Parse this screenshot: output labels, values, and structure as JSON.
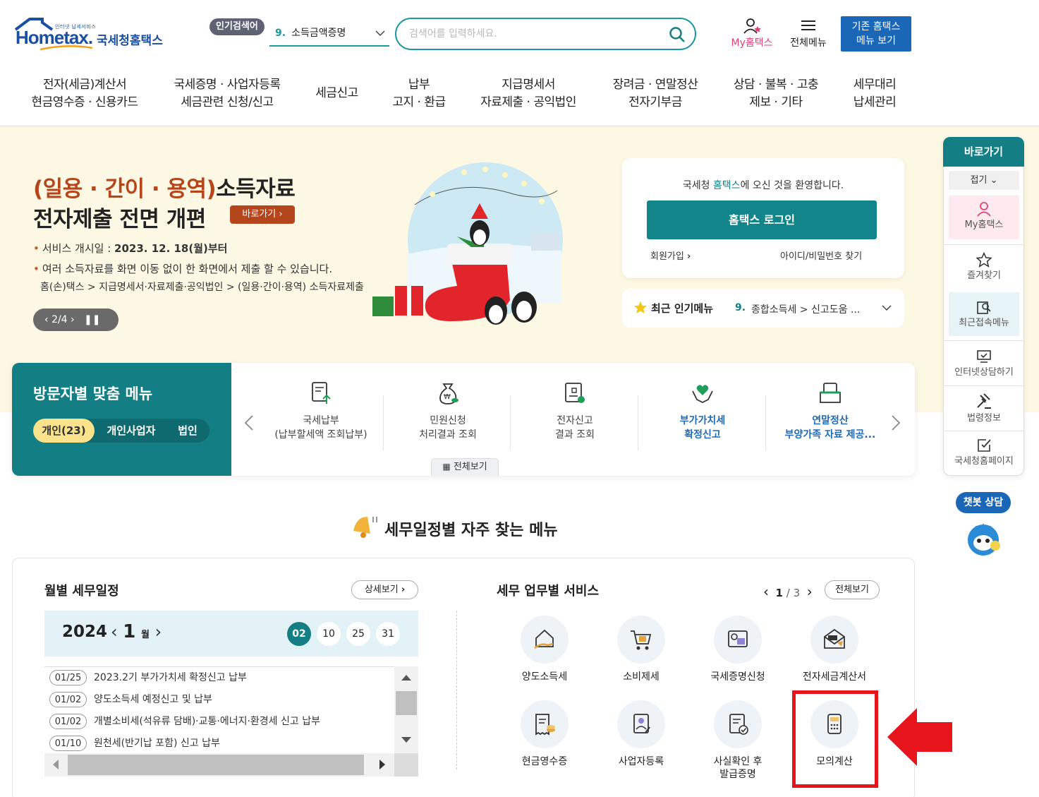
{
  "header": {
    "logo_sub": "인터넷 납세서비스",
    "logo_main": "Hometax.",
    "logo_kr": "국세청홈택스",
    "popular_badge": "인기검색어",
    "popular_num": "9.",
    "popular_term": "소득금액증명",
    "search_placeholder": "검색어를 입력하세요.",
    "my_hometax": "My홈택스",
    "all_menu": "전체메뉴",
    "old_menu_line1": "기존 홈택스",
    "old_menu_line2": "메뉴 보기"
  },
  "gnb": [
    {
      "l1": "전자(세금)계산서",
      "l2": "현금영수증 · 신용카드"
    },
    {
      "l1": "국세증명 · 사업자등록",
      "l2": "세금관련 신청/신고"
    },
    {
      "l1": "세금신고",
      "l2": ""
    },
    {
      "l1": "납부",
      "l2": "고지 · 환급"
    },
    {
      "l1": "지급명세서",
      "l2": "자료제출 · 공익법인"
    },
    {
      "l1": "장려금 · 연말정산",
      "l2": "전자기부금"
    },
    {
      "l1": "상담 · 불복 · 고충",
      "l2": "제보 · 기타"
    },
    {
      "l1": "세무대리",
      "l2": "납세관리"
    }
  ],
  "hero": {
    "title_red": "(일용 · 간이 · 용역)",
    "title_rest": "소득자료",
    "title2": "전자제출 전면 개편",
    "go_button": "바로가기",
    "bullet1_label": "서비스 개시일 : ",
    "bullet1_value": "2023. 12. 18(월)부터",
    "bullet2": "여러 소득자료를 화면 이동 없이 한 화면에서 제출 할 수 있습니다.",
    "path": "홈(손)택스 > 지급명세서·자료제출·공익법인 > (일용·간이·용역) 소득자료제출",
    "pager": "2/4"
  },
  "login": {
    "welcome_pre": "국세청 ",
    "welcome_brand": "홈택스",
    "welcome_post": "에 오신 것을 환영합니다.",
    "login_button": "홈택스 로그인",
    "join": "회원가입",
    "find": "아이디/비밀번호 찾기"
  },
  "recent": {
    "label": "최근 인기메뉴",
    "num": "9.",
    "text": "종합소득세 > 신고도움 ..."
  },
  "visitor": {
    "title": "방문자별 맞춤 메뉴",
    "tabs": [
      "개인(23)",
      "개인사업자",
      "법인"
    ],
    "items": [
      {
        "l1": "국세납부",
        "l2": "(납부할세액 조회납부)"
      },
      {
        "l1": "민원신청",
        "l2": "처리결과 조회"
      },
      {
        "l1": "전자신고",
        "l2": "결과 조회"
      },
      {
        "l1": "부가가치세",
        "l2": "확정신고"
      },
      {
        "l1": "연말정산",
        "l2": "부양가족 자료 제공..."
      }
    ],
    "view_all": "전체보기"
  },
  "section_title": "세무일정별 자주 찾는 메뉴",
  "calendar": {
    "title": "월별 세무일정",
    "detail": "상세보기",
    "year": "2024",
    "month": "1",
    "month_unit": "월",
    "days": [
      "02",
      "10",
      "25",
      "31"
    ],
    "schedule": [
      {
        "date": "01/25",
        "text": "2023.2기 부가가치세 확정신고 납부"
      },
      {
        "date": "01/02",
        "text": "양도소득세 예정신고 및 납부"
      },
      {
        "date": "01/02",
        "text": "개별소비세(석유류 담배)·교통·에너지·환경세 신고 납부"
      },
      {
        "date": "01/10",
        "text": "원천세(반기납 포함) 신고 납부"
      }
    ]
  },
  "services": {
    "title": "세무 업무별 서비스",
    "page_current": "1",
    "page_total": "/ 3",
    "view_all": "전체보기",
    "items": [
      {
        "l1": "양도소득세",
        "l2": "",
        "icon": "house-hand-icon"
      },
      {
        "l1": "소비제세",
        "l2": "",
        "icon": "cart-icon"
      },
      {
        "l1": "국세증명신청",
        "l2": "",
        "icon": "certificate-icon"
      },
      {
        "l1": "전자세금계산서",
        "l2": "",
        "icon": "tax-envelope-icon"
      },
      {
        "l1": "현금영수증",
        "l2": "",
        "icon": "receipt-coin-icon"
      },
      {
        "l1": "사업자등록",
        "l2": "",
        "icon": "business-register-icon"
      },
      {
        "l1": "사실확인 후",
        "l2": "발급증명",
        "icon": "verified-doc-icon"
      },
      {
        "l1": "모의계산",
        "l2": "",
        "icon": "calculator-icon"
      }
    ]
  },
  "quickbar": {
    "title": "바로가기",
    "fold": "접기",
    "items": [
      "My홈택스",
      "즐겨찾기",
      "최근접속메뉴",
      "인터넷상담하기",
      "법령정보",
      "국세청홈페이지"
    ]
  },
  "chatbot": "챗봇 상담",
  "colors": {
    "teal": "#137f84",
    "brand_blue": "#1a4fa3",
    "highlight_red": "#e8141c"
  }
}
